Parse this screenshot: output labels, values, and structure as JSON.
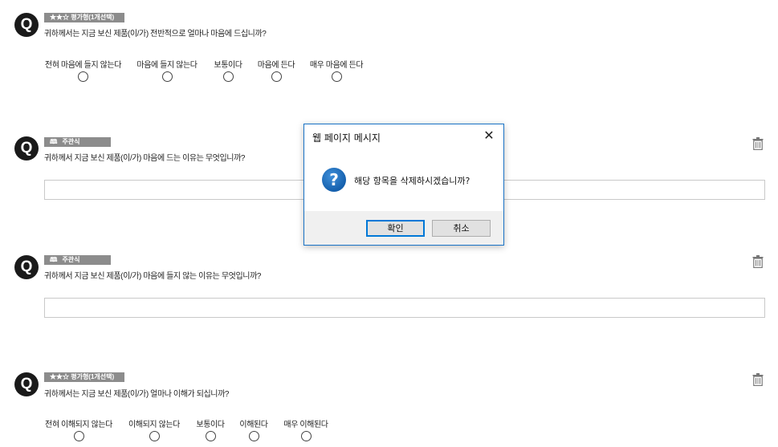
{
  "questions": [
    {
      "type_label": "★★☆ 평가형(1개선택)",
      "text": "귀하께서는 지금 보신 제품(이/가) 전반적으로 얼마나 마음에 드십니까?",
      "options": [
        "전혀 마음에 들지 않는다",
        "마음에 들지 않는다",
        "보통이다",
        "마음에 든다",
        "매우 마음에 든다"
      ]
    },
    {
      "type_label": "주관식",
      "text": "귀하께서 지금 보신 제품(이/가) 마음에 드는 이유는 무엇입니까?",
      "answer": ""
    },
    {
      "type_label": "주관식",
      "text": "귀하께서 지금 보신 제품(이/가) 마음에 들지 않는 이유는 무엇입니까?",
      "answer": ""
    },
    {
      "type_label": "★★☆ 평가형(1개선택)",
      "text": "귀하께서는 지금 보신 제품(이/가) 얼마나 이해가 되십니까?",
      "options": [
        "전혀 이해되지 않는다",
        "이해되지 않는다",
        "보통이다",
        "이해된다",
        "매우 이해된다"
      ]
    }
  ],
  "q_badge": "Q",
  "icons": {
    "question": "q-circle-icon",
    "delete": "trash-icon",
    "memo": "memo-icon"
  },
  "dialog": {
    "title": "웹 페이지 메시지",
    "close": "✕",
    "icon_glyph": "?",
    "message": "해당 항목을 삭제하시겠습니까?",
    "ok_label": "확인",
    "cancel_label": "취소",
    "accent_color": "#1a73c6"
  }
}
